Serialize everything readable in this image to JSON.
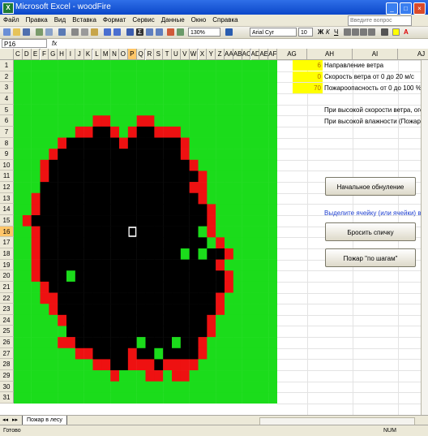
{
  "window": {
    "title": "Microsoft Excel - woodFire",
    "app_icon": "X"
  },
  "menu": {
    "items": [
      "Файл",
      "Правка",
      "Вид",
      "Вставка",
      "Формат",
      "Сервис",
      "Данные",
      "Окно",
      "Справка"
    ],
    "help_placeholder": "Введите вопрос"
  },
  "toolbar": {
    "zoom": "130%",
    "font_name": "Arial Cyr",
    "font_size": "10"
  },
  "formula_bar": {
    "name_box": "P16",
    "fx": "fx"
  },
  "grid": {
    "columns": [
      "C",
      "D",
      "E",
      "F",
      "G",
      "H",
      "I",
      "J",
      "K",
      "L",
      "M",
      "N",
      "O",
      "P",
      "Q",
      "R",
      "S",
      "T",
      "U",
      "V",
      "W",
      "X",
      "Y",
      "Z",
      "AA",
      "AB",
      "AC",
      "AD",
      "AE",
      "AF",
      "AG",
      "AH",
      "AI",
      "AJ"
    ],
    "selected_column": "P",
    "rows": [
      "1",
      "2",
      "3",
      "4",
      "5",
      "6",
      "7",
      "8",
      "9",
      "10",
      "11",
      "12",
      "13",
      "14",
      "15",
      "16",
      "17",
      "18",
      "19",
      "20",
      "21",
      "22",
      "23",
      "24",
      "25",
      "26",
      "27",
      "28",
      "29",
      "30",
      "31"
    ],
    "selected_row": "16"
  },
  "params": [
    {
      "value": "6",
      "label": "Направление ветра"
    },
    {
      "value": "0",
      "label": "Скорость ветра от 0 до 20 м/с"
    },
    {
      "value": "70",
      "label": "Пожароопасность от 0 до 100 %"
    }
  ],
  "notes": [
    "При высокой скорости ветра, огон",
    "При высокой влажности (Пожарос"
  ],
  "buttons": {
    "reset": "Начальное обнуление",
    "instruction": "Выделите ячейку (или ячейки) в л",
    "match": "Бросить спичку",
    "step": "Пожар \"по шагам\""
  },
  "sheet_tab": "Пожар в лесу",
  "status": {
    "text": "Готово",
    "num": "NUM"
  },
  "colors": {
    "forest": "#1bdc1b",
    "fire": "#ee1111",
    "burnt": "#000000",
    "param_fill": "#ffff00",
    "selection": "#ffc669"
  },
  "forest_map": [
    "GGGGGGGGGGGGGGGGGGGGGGGGGGGGGG",
    "GGGGGGGGGGGGGGGGGGGGGGGGGGGGGG",
    "GGGGGGGGGGGGGGGGGGGGGGGGGGGGGG",
    "GGGGGGGGGGGGGGGGGGGGGGGGGGGGGG",
    "GGGGGGGGGGGGGGGGGGGGGGGGGGGGGG",
    "GGGGGGGGGRRGGGRRGGGGGGGGGGGGGG",
    "GGGGGGGRRBBRGRBBRRRGGGGGGGGGGG",
    "GGGGGRBBBBBBRBBBBBBRGGGGGGGGGG",
    "GGGGRBBBBBBBBBBBBBBRGGGGGGGGGG",
    "GGGRBBBBBBBBBBBBBBBBRGGGGGGGGG",
    "GGGRBBBBBBBBBBBBBBBBBRGGGGGGGG",
    "GGGBBBBBBBBBBBBBBBBBRRGGGGGGGG",
    "GGRBBBBBBBBBBBBBBBBBBRGGGGGGGG",
    "GGRBBBBBBBBBBBBBBBBBBBRGGGGGGG",
    "GRBBBBBBBBBBBBBBBBBBBBRGGGGGGG",
    "GGRBBBBBBBBBBBBBBBBBBGRGGGGGGG",
    "GGRBBBBBBBBBBBBBBBBBBBGRGGGGGG",
    "GGRBBBBBBBBBBBBBBBBGBGBBRGGGGG",
    "GGRBBBBBBBBBBBBBBBBBBBBRGGGGGG",
    "GGRBBBGBBBBBBBBBBBBBBBBBRGGGGG",
    "GGGRBBBBBBBBBBBBBBBBBBBBRGGGGG",
    "GGGRRBBBBBBBBBBBBBBBBBBRGGGGGG",
    "GGGGRBBBBBBBBBBBBBBBBBBRGGGGGG",
    "GGGGGRBBBBBBBBBBBBBBBBRGGGGGGG",
    "GGGGGGBBBBBBBBBBBBBBBBRGGGGGGG",
    "GGGGGRRBBBBBBBGBBBGBBRGGGGGGGG",
    "GGGGGGGRRBBBBRBBGBBBBRGGGGGGGG",
    "GGGGGGGGGRRBBRRRBRRRRGGGGGGGGG",
    "GGGGGGGGGGGRGGGRRGRRGGGGGGGGGG",
    "GGGGGGGGGGGGGGGGGGGGGGGGGGGGGG",
    "GGGGGGGGGGGGGGGGGGGGGGGGGGGGGG"
  ]
}
